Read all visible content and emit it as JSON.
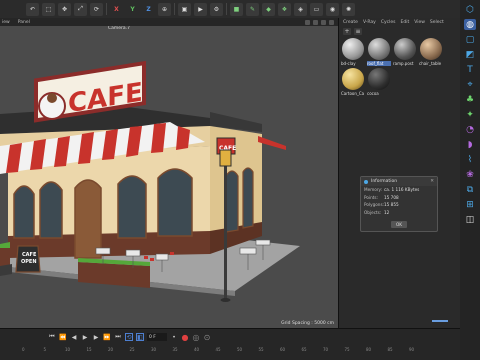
{
  "viewport": {
    "menu": [
      "iew",
      "Panel"
    ],
    "camera_label": "Camera.7",
    "grid_spacing": "Grid Spacing : 5000 cm"
  },
  "scene": {
    "sign_text": "CAFE",
    "small_sign_text": "CAFE",
    "board_text": [
      "CAFE",
      "OPEN"
    ]
  },
  "materials": {
    "menu": [
      "Create",
      "V-Ray",
      "Cycles",
      "Edit",
      "View",
      "Select"
    ],
    "items": [
      {
        "name": "bd-clay",
        "color": "#b8b8b8",
        "selected": false
      },
      {
        "name": "roof_flat",
        "color": "#9c9c9c",
        "selected": true
      },
      {
        "name": "ramp.post",
        "color": "#6a6a6a",
        "selected": false
      },
      {
        "name": "chair_table",
        "color": "#8a6b4f",
        "selected": false
      },
      {
        "name": "Cartoon_Ca",
        "color": "#c9a64a",
        "selected": false
      },
      {
        "name": "cocoa",
        "color": "#2e2e2e",
        "selected": false
      }
    ]
  },
  "info_dialog": {
    "title": "Information",
    "rows": [
      {
        "key": "Memory:",
        "value": "ca. 1 116 KBytes"
      },
      {
        "key": "Points:",
        "value": "15 708"
      },
      {
        "key": "Polygons:",
        "value": "15 855"
      },
      {
        "key": "Objects:",
        "value": "12"
      }
    ],
    "ok_label": "OK"
  },
  "timeline": {
    "current_frame": "0 F",
    "ticks": [
      "0",
      "5",
      "10",
      "15",
      "20",
      "25",
      "30",
      "35",
      "40",
      "45",
      "50",
      "55",
      "60",
      "65",
      "70",
      "75",
      "80",
      "85",
      "90"
    ]
  }
}
